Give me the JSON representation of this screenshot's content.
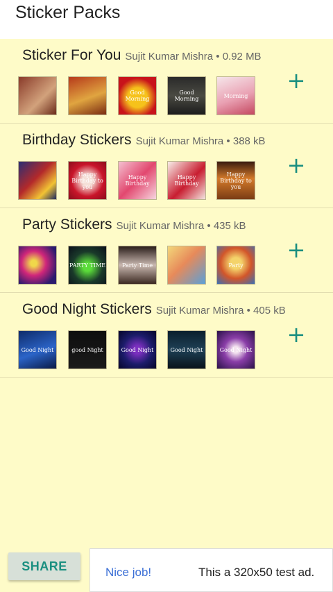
{
  "app": {
    "title": "Sticker Packs"
  },
  "packs": [
    {
      "name": "Sticker For You",
      "author": "Sujit Kumar Mishra",
      "size": "0.92 MB",
      "add_icon": "plus-icon",
      "thumbs": [
        {
          "label": "",
          "bg": "linear-gradient(135deg,#8a3b2a,#d2a27c 60%,#6b2b1a)"
        },
        {
          "label": "",
          "bg": "linear-gradient(160deg,#b63a1b,#e0a540 55%,#7a2b12)"
        },
        {
          "label": "Good Morning",
          "bg": "radial-gradient(circle at 50% 55%,#f6c21b 35%,#c8131b 70%)"
        },
        {
          "label": "Good Morning",
          "bg": "linear-gradient(180deg,#2a2a2a,#4a4a42 50%,#1c1c1c)"
        },
        {
          "label": "Morning",
          "bg": "linear-gradient(160deg,#f6e6ea,#e9a0b2 55%,#c44860)"
        }
      ]
    },
    {
      "name": "Birthday Stickers",
      "author": "Sujit Kumar Mishra",
      "size": "388 kB",
      "add_icon": "plus-icon",
      "thumbs": [
        {
          "label": "",
          "bg": "linear-gradient(135deg,#2a2f73,#b3292a 45%,#f2c334 75%,#1e2a60)"
        },
        {
          "label": "Happy Birthday to you",
          "bg": "radial-gradient(circle at 50% 50%,#f5e0d8 20%,#c9152a 60%,#8c0d1c)"
        },
        {
          "label": "Happy Birthday",
          "bg": "linear-gradient(135deg,#f4c0d0,#e2486f 50%,#f7d6e0)"
        },
        {
          "label": "Happy Birthday",
          "bg": "linear-gradient(135deg,#f8eee9,#c81d30 55%,#f3e6e0)"
        },
        {
          "label": "Happy Birthday to you",
          "bg": "linear-gradient(180deg,#3a1c10,#d47a2a 45%,#7a3c14)"
        }
      ]
    },
    {
      "name": "Party Stickers",
      "author": "Sujit Kumar Mishra",
      "size": "435 kB",
      "add_icon": "plus-icon",
      "thumbs": [
        {
          "label": "",
          "bg": "radial-gradient(circle at 40% 45%,#f0d84a 10%,#d0267a 40%,#2b1b6e 80%)"
        },
        {
          "label": "PARTY TIME",
          "bg": "radial-gradient(circle at 50% 55%,#5bdc3a 15%,#1a3a2a 55%,#0a0f1a)"
        },
        {
          "label": "Party Time",
          "bg": "linear-gradient(180deg,#2a1e1a,#c9b8b0 50%,#3c2a22)"
        },
        {
          "label": "",
          "bg": "linear-gradient(135deg,#f3d77a,#e78a5a 45%,#5aa0d8)"
        },
        {
          "label": "Party",
          "bg": "radial-gradient(circle at 50% 45%,#f4d36a 20%,#d2562a 55%,#3b6fb3)"
        }
      ]
    },
    {
      "name": "Good Night Stickers",
      "author": "Sujit Kumar Mishra",
      "size": "405 kB",
      "add_icon": "plus-icon",
      "thumbs": [
        {
          "label": "Good Night",
          "bg": "linear-gradient(160deg,#0f2c6b,#2b64c8 55%,#0a1a46)"
        },
        {
          "label": "good Night",
          "bg": "linear-gradient(180deg,#0e0e0e,#1a1a1a)"
        },
        {
          "label": "Good Night",
          "bg": "radial-gradient(circle at 50% 50%,#7b2fbf 15%,#1c1c6a 55%,#06062a)"
        },
        {
          "label": "Good Night",
          "bg": "linear-gradient(180deg,#0b1f2e,#1e4055 50%,#08121a)"
        },
        {
          "label": "Good Night",
          "bg": "radial-gradient(circle at 50% 50%,#f4e3f0 12%,#8a3ea8 45%,#2a1048)"
        }
      ]
    }
  ],
  "footer": {
    "share_label": "SHARE",
    "ad_prefix": "Nice job!",
    "ad_text": "This a 320x50 test ad."
  }
}
